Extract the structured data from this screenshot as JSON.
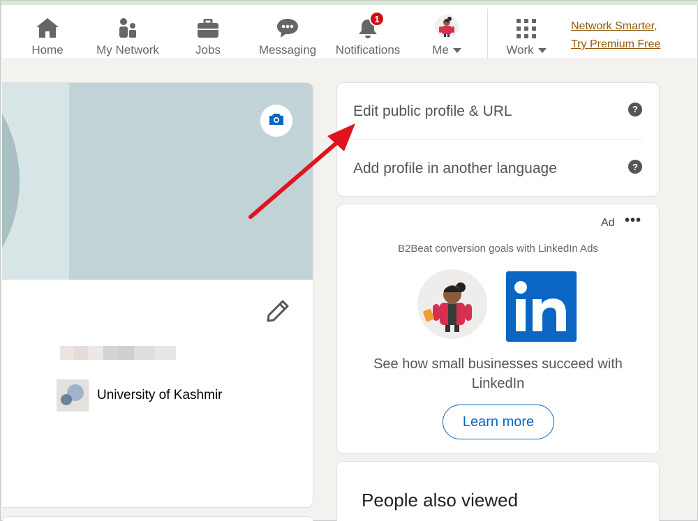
{
  "nav": {
    "items": [
      {
        "label": "Home",
        "icon": "home-icon"
      },
      {
        "label": "My Network",
        "icon": "network-icon"
      },
      {
        "label": "Jobs",
        "icon": "briefcase-icon"
      },
      {
        "label": "Messaging",
        "icon": "messaging-icon"
      },
      {
        "label": "Notifications",
        "icon": "bell-icon"
      },
      {
        "label": "Me",
        "icon": "avatar"
      },
      {
        "label": "Work",
        "icon": "grid-icon"
      }
    ],
    "notifications_badge": "1",
    "premium_line1": "Network Smarter,",
    "premium_line2": "Try Premium Free"
  },
  "profile": {
    "school": "University of Kashmir"
  },
  "profile_settings": {
    "edit_public": "Edit public profile & URL",
    "add_language": "Add profile in another language",
    "help_glyph": "?"
  },
  "ad": {
    "label": "Ad",
    "more": "•••",
    "tagline": "B2Beat conversion goals with LinkedIn Ads",
    "logo_text": "in",
    "text": "See how small businesses succeed with LinkedIn",
    "button": "Learn more"
  },
  "people": {
    "title": "People also viewed"
  },
  "colors": {
    "linkedin_blue": "#0a66c2",
    "badge_red": "#cc1016",
    "premium_gold": "#915907",
    "arrow_red": "#e0141e"
  }
}
